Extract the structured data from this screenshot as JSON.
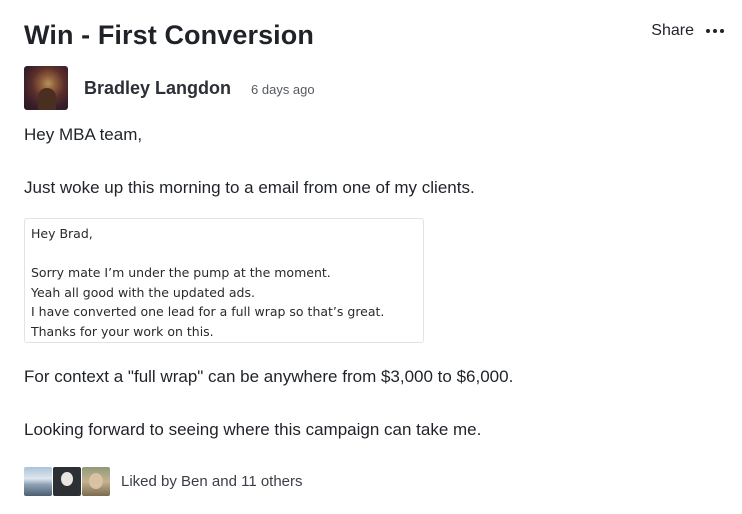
{
  "post": {
    "title": "Win - First Conversion",
    "actions": {
      "share_label": "Share",
      "more_icon": "more-horizontal-icon"
    },
    "author": {
      "name": "Bradley Langdon",
      "time": "6 days ago"
    },
    "paragraphs": [
      "Hey MBA team,",
      "Just woke up this morning to a email from one of my clients.",
      "For context a \"full wrap\" can be anywhere from $3,000 to $6,000.",
      "Looking forward to seeing where this campaign can take me."
    ],
    "email_image": {
      "lines": [
        "Hey Brad,",
        "",
        "Sorry mate I’m under the pump at the moment.",
        "Yeah all good with the updated ads.",
        "I have converted one lead for a full wrap so that’s great.",
        "Thanks for your work on this."
      ]
    },
    "likes": {
      "text": "Liked by Ben and 11 others"
    }
  }
}
